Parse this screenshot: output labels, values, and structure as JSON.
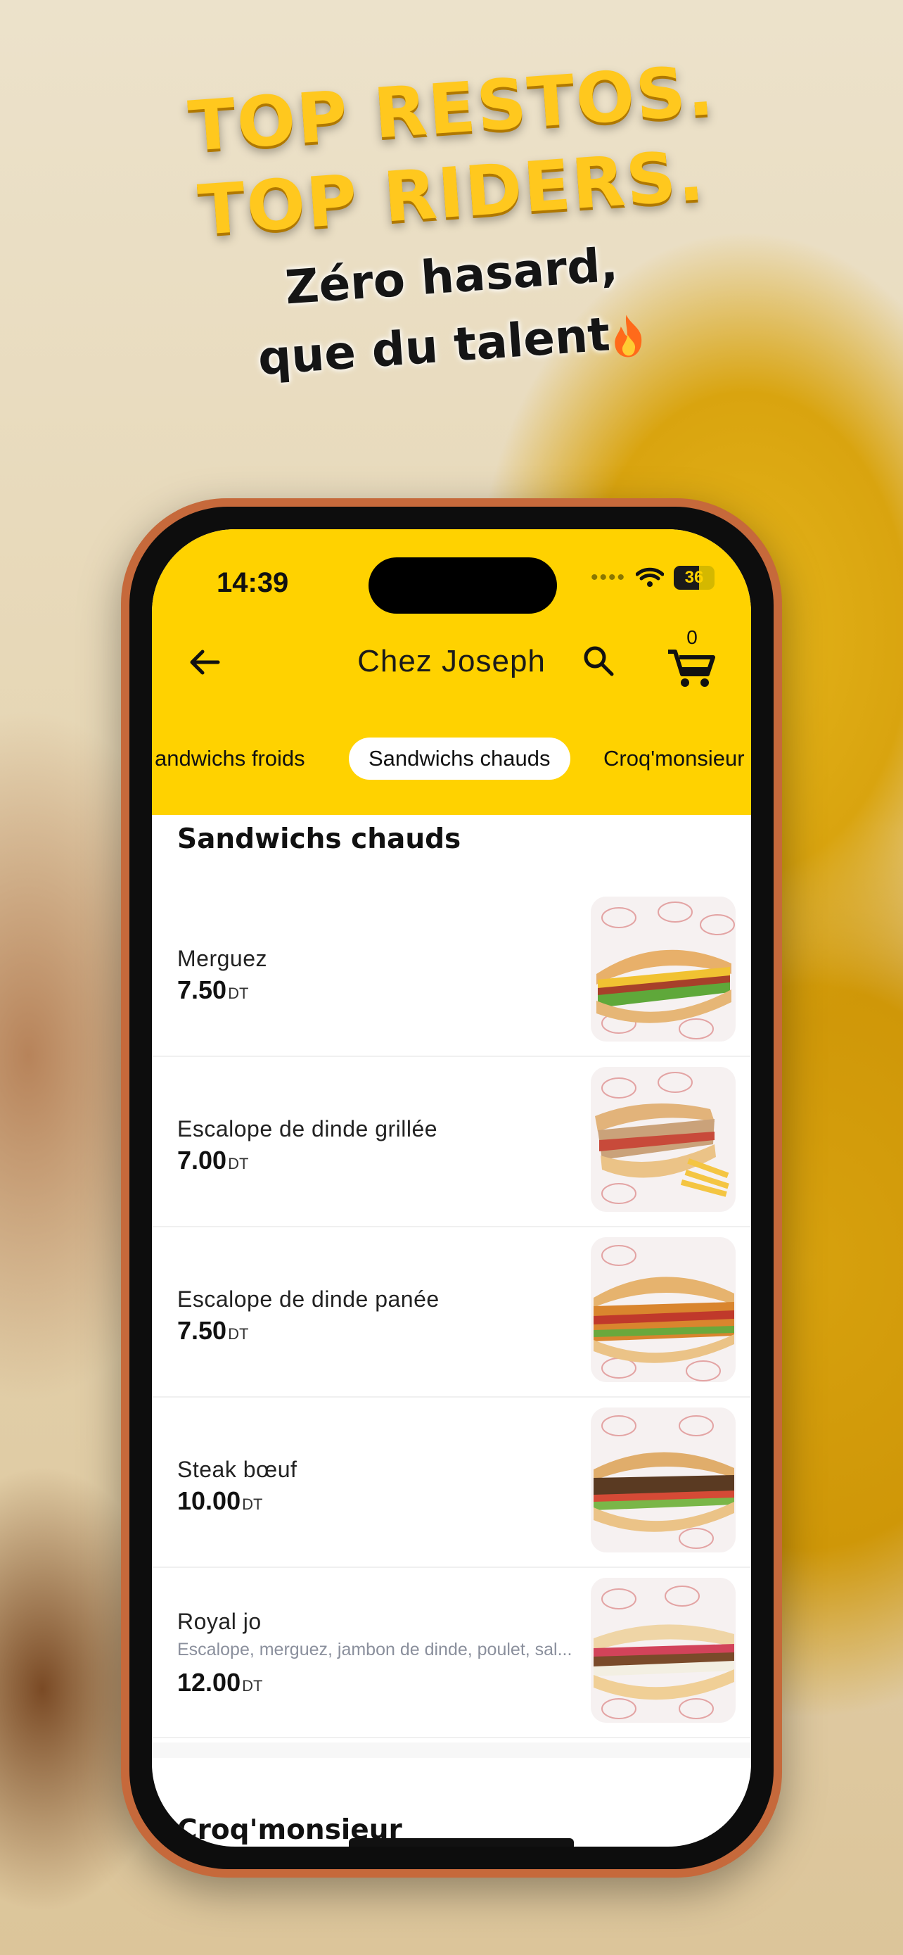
{
  "promo": {
    "headline_1": "TOP RESTOS.",
    "headline_2": "TOP RIDERS.",
    "tagline_1": "Zéro hasard,",
    "tagline_2": "que du talent"
  },
  "status_bar": {
    "time": "14:39",
    "battery": "36"
  },
  "header": {
    "title": "Chez Joseph",
    "cart_count": "0"
  },
  "tabs": [
    {
      "label": "andwichs froids",
      "active": false
    },
    {
      "label": "Sandwichs chauds",
      "active": true
    },
    {
      "label": "Croq'monsieur",
      "active": false
    }
  ],
  "sections": [
    {
      "title": "Sandwichs chauds",
      "items": [
        {
          "name": "Merguez",
          "price": "7.50",
          "currency": "DT",
          "description": ""
        },
        {
          "name": "Escalope de dinde grillée",
          "price": "7.00",
          "currency": "DT",
          "description": ""
        },
        {
          "name": "Escalope de dinde panée",
          "price": "7.50",
          "currency": "DT",
          "description": ""
        },
        {
          "name": "Steak bœuf",
          "price": "10.00",
          "currency": "DT",
          "description": ""
        },
        {
          "name": "Royal jo",
          "price": "12.00",
          "currency": "DT",
          "description": "Escalope, merguez, jambon de dinde, poulet, sal..."
        }
      ]
    },
    {
      "title": "Croq'monsieur",
      "items": []
    }
  ],
  "colors": {
    "brand_yellow": "#ffd200",
    "promo_yellow": "#ffc81e",
    "phone_frame": "#c6693b"
  }
}
